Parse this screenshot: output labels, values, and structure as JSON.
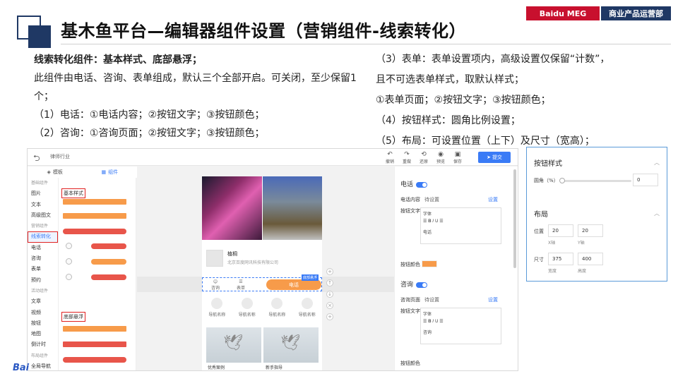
{
  "header": {
    "title": "基木鱼平台—编辑器组件设置（营销组件-线索转化）",
    "brand": "Baidu MEG",
    "dept": "商业产品运营部"
  },
  "left_text": {
    "heading": "线索转化组件：基本样式、底部悬浮；",
    "line1": "此组件由电话、咨询、表单组成，默认三个全部开启。可关闭，至少保留1个；",
    "line2": "（1）电话：①电话内容；②按钮文字；③按钮颜色；",
    "line3": "（2）咨询：①咨询页面；②按钮文字；③按钮颜色；"
  },
  "right_text": {
    "line1": "（3）表单：表单设置项内，高级设置仅保留“计数”，",
    "line2": "且不可选表单样式，取默认样式；",
    "line3": "①表单页面；②按钮文字；③按钮颜色；",
    "line4": "（4）按钮样式：圆角比例设置；",
    "line5": "（5）布局：可设置位置（上下）及尺寸（宽高）；"
  },
  "editor": {
    "back_icon": "back-arrow-icon",
    "category": "律师行业",
    "tools": [
      {
        "icon": "undo-icon",
        "label": "撤销"
      },
      {
        "icon": "redo-icon",
        "label": "重做"
      },
      {
        "icon": "reset-icon",
        "label": "还原"
      },
      {
        "icon": "eye-icon",
        "label": "预览"
      },
      {
        "icon": "save-icon",
        "label": "保存"
      }
    ],
    "submit": "提交",
    "tabs": [
      "模板",
      "组件"
    ],
    "sidebar": [
      {
        "label": "基础组件",
        "group": true
      },
      {
        "label": "图片"
      },
      {
        "label": "文本"
      },
      {
        "label": "高级图文"
      },
      {
        "label": "营销组件",
        "group": true
      },
      {
        "label": "线索转化",
        "selected": true
      },
      {
        "label": "电话"
      },
      {
        "label": "咨询"
      },
      {
        "label": "表单"
      },
      {
        "label": "预约"
      },
      {
        "label": "活动组件",
        "group": true
      },
      {
        "label": "文章"
      },
      {
        "label": "视频"
      },
      {
        "label": "按钮"
      },
      {
        "label": "地图"
      },
      {
        "label": "倒计时"
      },
      {
        "label": "布局组件",
        "group": true
      },
      {
        "label": "全局导航"
      }
    ],
    "comp_sections": [
      "基本样式",
      "底部悬浮"
    ],
    "canvas": {
      "company_name": "植桐",
      "company_sub": "北京百度网讯科技有限公司",
      "bar_items": [
        "咨询",
        "表单"
      ],
      "bar_call": "电话",
      "badge": "底部悬浮",
      "nav_label": "导航名称",
      "nav_count": 4,
      "bird_captions": [
        "优秀案例",
        "新手指导"
      ]
    },
    "props": {
      "phone_title": "电话",
      "phone_content_label": "电话内容",
      "phone_content_value": "待设置",
      "set_link": "设置",
      "btn_text_label": "按钮文字",
      "font_label": "字体",
      "phone_btn_text": "电话",
      "btn_color_label": "按钮颜色",
      "consult_title": "咨询",
      "consult_page_label": "咨询页面",
      "consult_page_value": "待设置",
      "consult_btn_text": "咨询",
      "accent": "#f79b4a"
    }
  },
  "panel": {
    "style_title": "按钮样式",
    "radius_label": "圆角（%）",
    "radius_value": "0",
    "layout_title": "布局",
    "pos_label": "位置",
    "x_value": "20",
    "y_value": "20",
    "x_cap": "X轴",
    "y_cap": "Y轴",
    "size_label": "尺寸",
    "w_value": "375",
    "h_value": "400",
    "w_cap": "宽度",
    "h_cap": "高度"
  },
  "watermark": "Bai"
}
